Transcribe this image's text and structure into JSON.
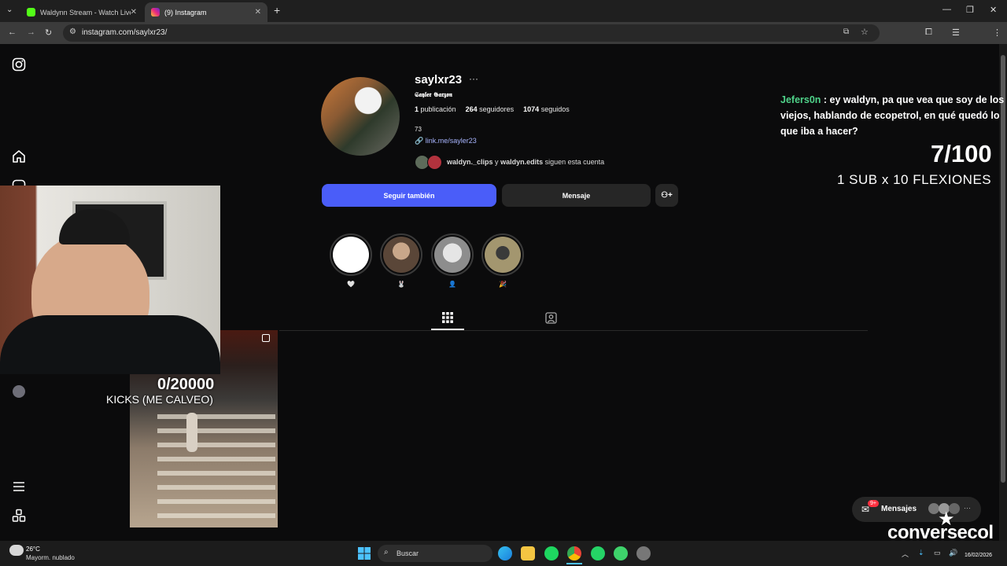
{
  "browser": {
    "tabs": [
      {
        "title": "Waldynn Stream - Watch Live o",
        "active": false,
        "favicon_color": "#53fc18"
      },
      {
        "title": "(9) Instagram",
        "active": true,
        "favicon_color": "#e1306c"
      }
    ],
    "new_tab": "+",
    "url": "instagram.com/saylxr23/",
    "window_controls": [
      "—",
      "❐",
      "✕"
    ]
  },
  "sidebar": {
    "icons": [
      "instagram-logo-icon",
      "home-icon",
      "reels-icon",
      "menu-icon",
      "apps-icon"
    ]
  },
  "profile": {
    "username": "saylxr23",
    "more": "···",
    "full_name": "𝕾𝖆𝖞𝖑𝖊𝖗 𝕲𝖆𝖗𝖟𝖔𝖓",
    "posts_count": "1",
    "posts_label": "publicación",
    "followers_count": "264",
    "followers_label": "seguidores",
    "following_count": "1074",
    "following_label": "seguidos",
    "bio": "73",
    "link": "link.me/sayler23",
    "followed_by_1": "waldyn._clips",
    "followed_by_and": "y",
    "followed_by_2": "waldyn.edits",
    "followed_by_suffix": "siguen esta cuenta"
  },
  "actions": {
    "follow_back": "Seguir también",
    "message": "Mensaje",
    "suggest_icon": "add-person-icon"
  },
  "highlights": [
    {
      "label": "🤍",
      "color": "#ffffff"
    },
    {
      "label": "🐰",
      "color": "#8a6d5a"
    },
    {
      "label": "👤",
      "color": "#b9b9b9"
    },
    {
      "label": "🎉",
      "color": "#6b6148"
    }
  ],
  "stream": {
    "kicks_count": "0/20000",
    "kicks_label": "KICKS (ME CALVEO)",
    "chat_user": "Jefers0n",
    "chat_text": ": ey waldyn, pa que vea que soy de los viejos, hablando de ecopetrol, en qué quedó lo que iba a hacer?",
    "goal_count": "7/100",
    "goal_label": "1 SUB x 10 FLEXIONES",
    "brand": "conversecol"
  },
  "messages_pill": {
    "label": "Mensajes",
    "badge": "9+"
  },
  "taskbar": {
    "weather_temp": "26°C",
    "weather_desc": "Mayorm. nublado",
    "search_placeholder": "Buscar",
    "date": "16/02/2026"
  }
}
